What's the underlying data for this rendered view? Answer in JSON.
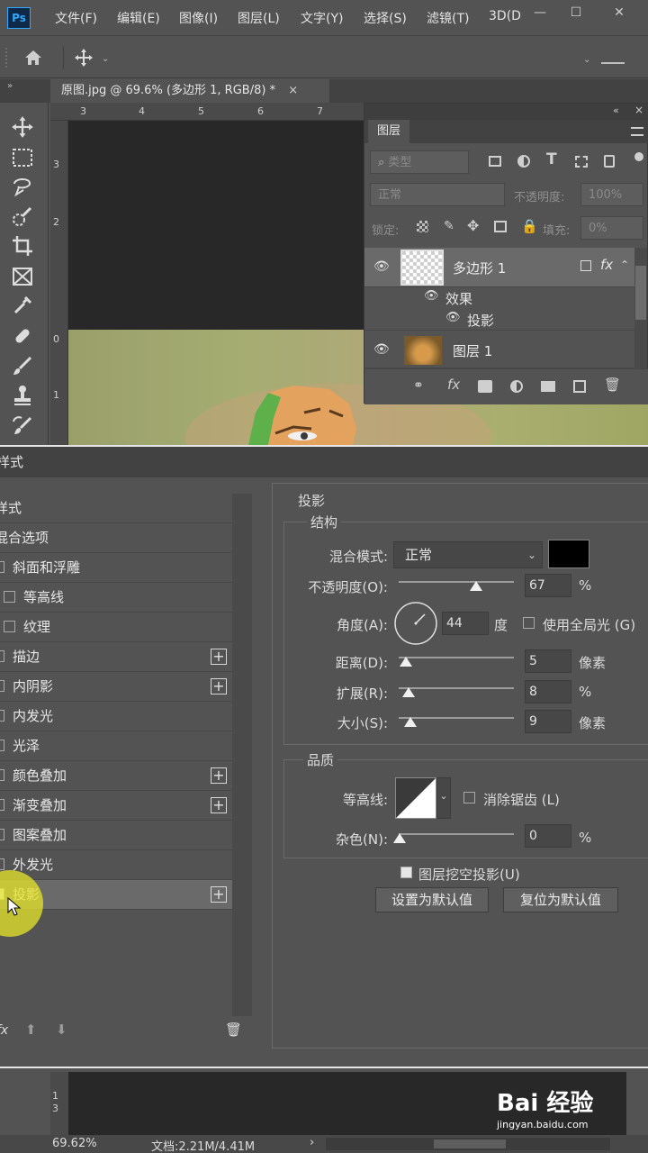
{
  "app": {
    "logo_text": "Ps"
  },
  "menu": {
    "items": [
      "文件(F)",
      "编辑(E)",
      "图像(I)",
      "图层(L)",
      "文字(Y)",
      "选择(S)",
      "滤镜(T)",
      "3D(D"
    ],
    "minimize": "—",
    "maximize": "☐",
    "close": "✕"
  },
  "document_tab": {
    "label": "原图.jpg @ 69.6% (多边形 1, RGB/8) *",
    "close": "×"
  },
  "ruler": {
    "top_ticks": [
      "3",
      "4",
      "5",
      "6",
      "7"
    ],
    "left_ticks": [
      "3",
      "2",
      "0",
      "1"
    ]
  },
  "layers_panel": {
    "title": "图层",
    "filter_placeholder": "类型",
    "blend_mode": "正常",
    "opacity_label": "不透明度:",
    "opacity_value": "100%",
    "lock_label": "锁定:",
    "fill_label": "填充:",
    "fill_value": "0%",
    "layers": [
      {
        "name": "多边形 1",
        "fx": "fx"
      },
      {
        "name": "效果"
      },
      {
        "name": "投影"
      },
      {
        "name": "图层 1"
      }
    ]
  },
  "dialog": {
    "title": "样式",
    "styles": [
      {
        "label": "样式",
        "checkbox": false,
        "plus": false
      },
      {
        "label": "混合选项",
        "checkbox": false,
        "plus": false
      },
      {
        "label": "斜面和浮雕",
        "checkbox": true,
        "plus": false
      },
      {
        "label": "等高线",
        "checkbox": true,
        "plus": false
      },
      {
        "label": "纹理",
        "checkbox": true,
        "plus": false
      },
      {
        "label": "描边",
        "checkbox": true,
        "plus": true
      },
      {
        "label": "内阴影",
        "checkbox": true,
        "plus": true
      },
      {
        "label": "内发光",
        "checkbox": true,
        "plus": false
      },
      {
        "label": "光泽",
        "checkbox": true,
        "plus": false
      },
      {
        "label": "颜色叠加",
        "checkbox": true,
        "plus": true
      },
      {
        "label": "渐变叠加",
        "checkbox": true,
        "plus": true
      },
      {
        "label": "图案叠加",
        "checkbox": true,
        "plus": false
      },
      {
        "label": "外发光",
        "checkbox": true,
        "plus": false
      },
      {
        "label": "投影",
        "checkbox": true,
        "plus": true,
        "selected": true
      }
    ],
    "section_title": "投影",
    "structure": {
      "title": "结构",
      "blend_mode_label": "混合模式:",
      "blend_mode_value": "正常",
      "shadow_color": "#000000",
      "opacity_label": "不透明度(O):",
      "opacity_value": "67",
      "opacity_unit": "%",
      "opacity_level": 0.67,
      "angle_label": "角度(A):",
      "angle_value": "44",
      "angle_unit": "度",
      "global_light_label": "使用全局光 (G)",
      "distance_label": "距离(D):",
      "distance_value": "5",
      "distance_unit": "像素",
      "spread_label": "扩展(R):",
      "spread_value": "8",
      "spread_unit": "%",
      "size_label": "大小(S):",
      "size_value": "9",
      "size_unit": "像素"
    },
    "quality": {
      "title": "品质",
      "contour_label": "等高线:",
      "antialias_label": "消除锯齿 (L)",
      "noise_label": "杂色(N):",
      "noise_value": "0",
      "noise_unit": "%"
    },
    "knockout_label": "图层挖空投影(U)",
    "make_default": "设置为默认值",
    "reset_default": "复位为默认值",
    "footer_fx": "fx"
  },
  "bottom_ruler_ticks": [
    "1",
    "3"
  ],
  "statusbar": {
    "zoom": "69.62%",
    "doc_info": "文档:2.21M/4.41M",
    "arrow": "›"
  },
  "watermark": {
    "brand": "Bai 经验",
    "url": "jingyan.baidu.com"
  }
}
